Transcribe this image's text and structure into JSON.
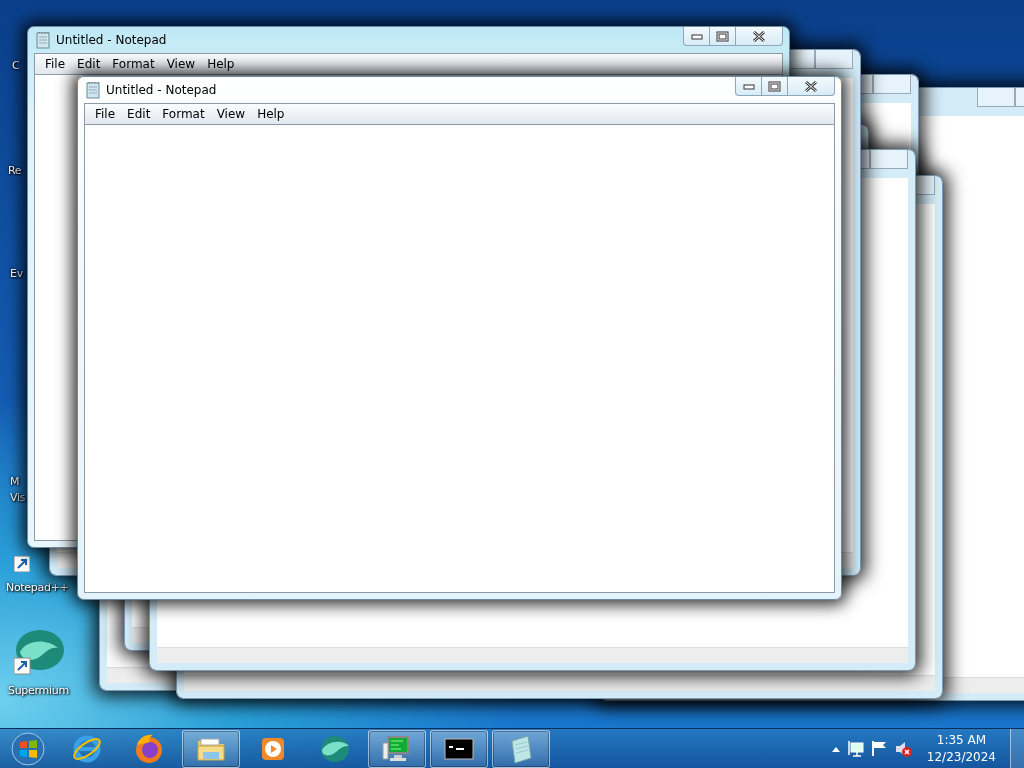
{
  "desktop_icons": [
    {
      "kind": "partial",
      "lines": [
        "C"
      ]
    },
    {
      "kind": "partial",
      "lines": [
        "Re"
      ]
    },
    {
      "kind": "partial",
      "lines": [
        "Ev"
      ]
    },
    {
      "kind": "partial",
      "lines": [
        "M",
        "Vis"
      ]
    },
    {
      "kind": "notepadpp",
      "lines": [
        "Notepad++"
      ]
    },
    {
      "kind": "supermium",
      "lines": [
        "Supermium"
      ]
    }
  ],
  "windows": [
    {
      "title": "Untitled - Notepad",
      "menu": [
        "File",
        "Edit",
        "Format",
        "View",
        "Help"
      ]
    },
    {
      "title": "Untitled - Notepad",
      "menu": [
        "File",
        "Edit",
        "Format",
        "View",
        "Help"
      ]
    }
  ],
  "taskbar": {
    "items": [
      {
        "kind": "browser-e",
        "running": false
      },
      {
        "kind": "browser-fox",
        "running": false
      },
      {
        "kind": "folder",
        "running": true
      },
      {
        "kind": "player",
        "running": false
      },
      {
        "kind": "globe",
        "running": false
      },
      {
        "kind": "monitor",
        "running": true
      },
      {
        "kind": "terminal",
        "running": true
      },
      {
        "kind": "notepad",
        "running": true
      }
    ],
    "volume_muted": true,
    "time": "1:35 AM",
    "date": "12/23/2024"
  }
}
